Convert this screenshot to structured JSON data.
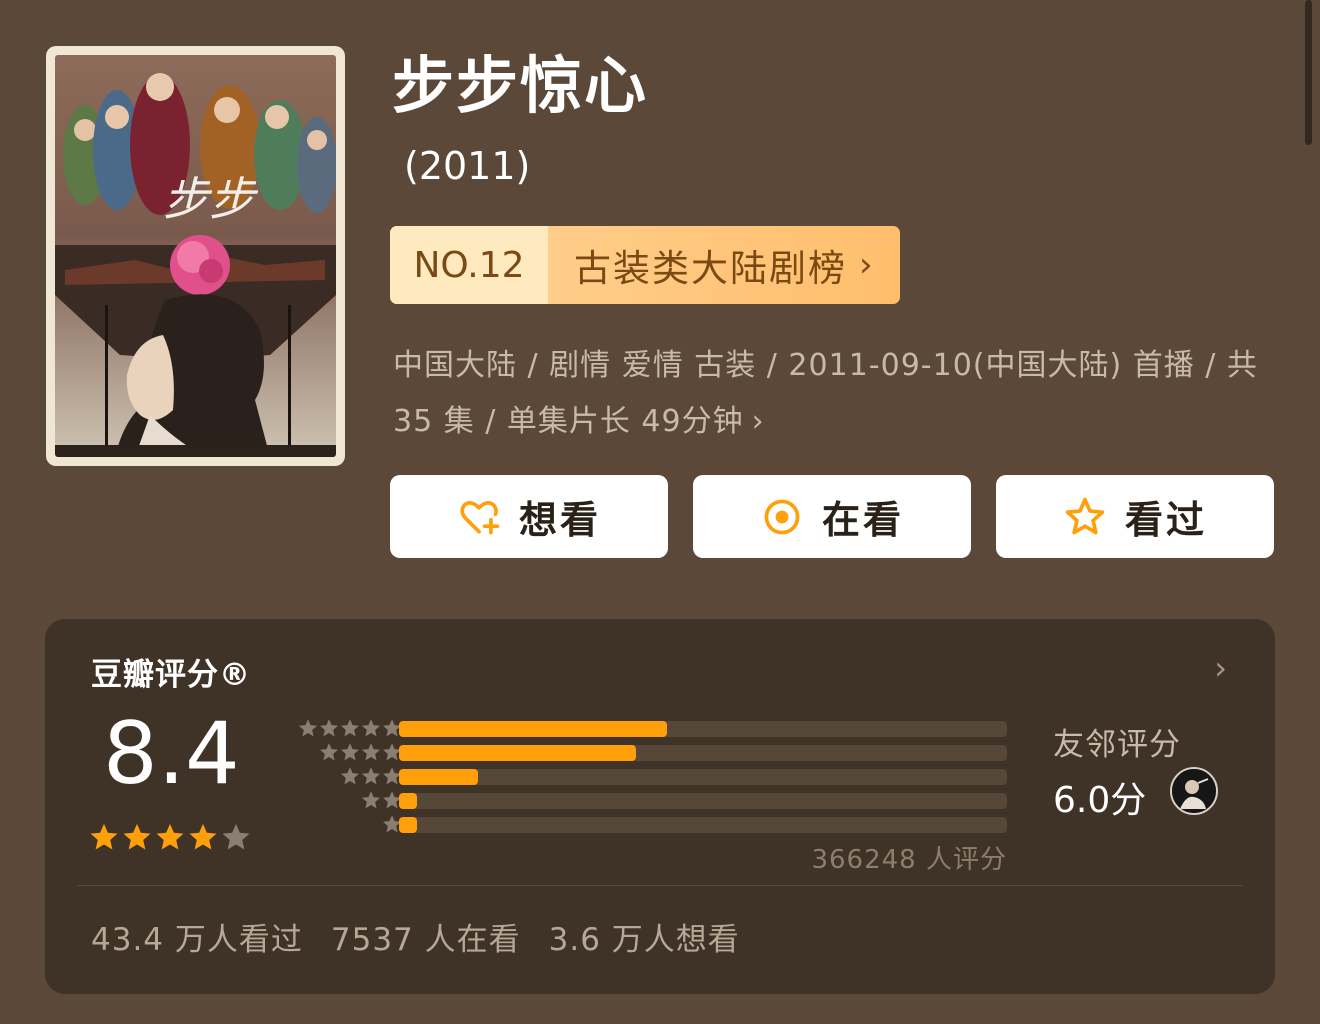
{
  "header": {
    "title": "步步惊心",
    "year": "(2011)",
    "rank": {
      "number": "NO.12",
      "label": "古装类大陆剧榜",
      "chevron": "›"
    }
  },
  "meta": {
    "line": "中国大陆 / 剧情 爱情 古装 / 2011-09-10(中国大陆) 首播 / 共 35 集 / 单集片长 49分钟",
    "chevron": "›"
  },
  "actions": [
    {
      "label": "想看",
      "icon": "heart-plus-icon"
    },
    {
      "label": "在看",
      "icon": "target-icon"
    },
    {
      "label": "看过",
      "icon": "star-outline-icon"
    }
  ],
  "rating": {
    "heading": "豆瓣评分®",
    "chevron": "›",
    "score": "8.4",
    "stars_filled": 4,
    "stars_total": 5,
    "distribution": [
      {
        "stars": 5,
        "fraction": 0.44
      },
      {
        "stars": 4,
        "fraction": 0.39
      },
      {
        "stars": 3,
        "fraction": 0.13
      },
      {
        "stars": 2,
        "fraction": 0.03
      },
      {
        "stars": 1,
        "fraction": 0.03
      }
    ],
    "votes": "366248 人评分",
    "friends": {
      "label": "友邻评分",
      "score": "6.0分"
    }
  },
  "stats": {
    "watched": "43.4 万人看过",
    "watching": "7537 人在看",
    "wish": "3.6 万人想看"
  },
  "colors": {
    "background": "#5b4838",
    "card": "#3f3226",
    "accent": "#ff9f0a",
    "badge": "#ffbe6c",
    "star_inactive": "#8a7e74"
  }
}
